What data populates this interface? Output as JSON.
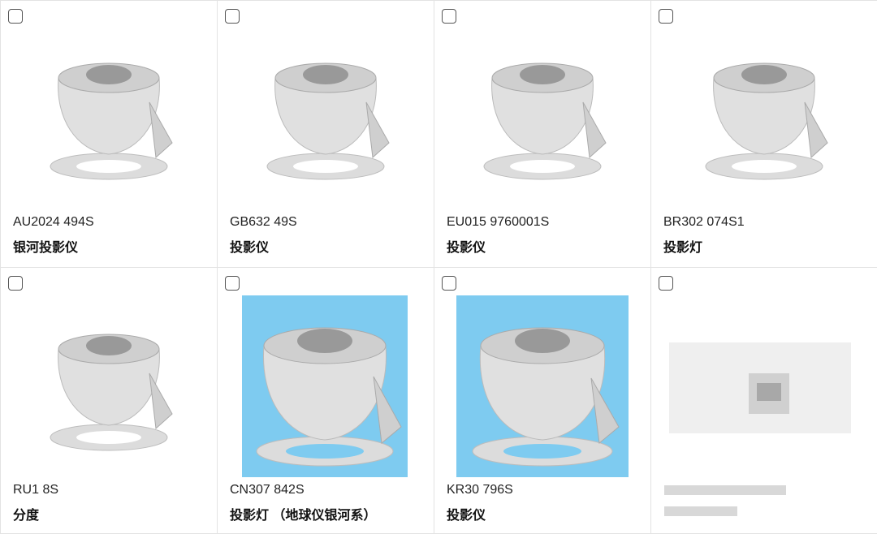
{
  "colors": {
    "border": "#e3e3e3",
    "thumbnail_blue": "#7ecbf0",
    "product_gray": "#d9d9d9"
  },
  "icons": [
    "projector-icon",
    "checkbox-icon"
  ],
  "cards": [
    {
      "code": "AU2024 494S",
      "name": "银河投影仪",
      "selected": false
    },
    {
      "code": "GB632 49S",
      "name": "投影仪",
      "selected": false
    },
    {
      "code": "EU015 9760001S",
      "name": "投影仪",
      "selected": false
    },
    {
      "code": "BR302 074S1",
      "name": "投影灯",
      "selected": false
    },
    {
      "code": "RU1 8S",
      "name": "分度",
      "selected": false
    },
    {
      "code": "CN307 842S",
      "name": "投影灯 （地球仪银河系）",
      "selected": false
    },
    {
      "code": "KR30 796S",
      "name": "投影仪",
      "selected": false
    },
    {
      "code": "",
      "name": "",
      "selected": false
    }
  ]
}
